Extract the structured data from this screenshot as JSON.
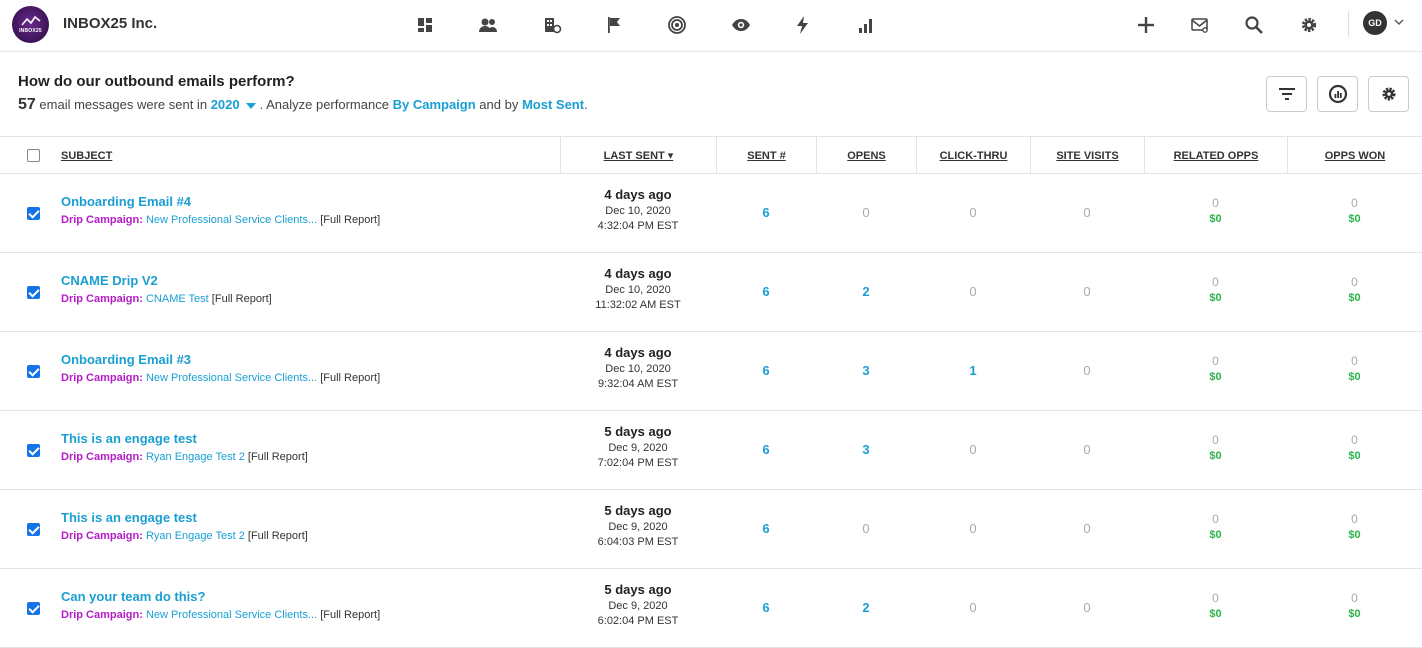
{
  "app": {
    "company": "INBOX25 Inc.",
    "logo_text": "INBOX25",
    "user_initials": "GD"
  },
  "nav_icons": [
    "dashboard-icon",
    "contacts-icon",
    "accounts-icon",
    "flag-icon",
    "target-icon",
    "eye-icon",
    "bolt-icon",
    "bar-chart-icon"
  ],
  "utility_icons": [
    "plus-icon",
    "mail-search-icon",
    "search-icon",
    "gear-icon"
  ],
  "header": {
    "title": "How do our outbound emails perform?",
    "count": "57",
    "text1": "email messages were sent in",
    "year": "2020",
    "text2": ". Analyze performance",
    "by_campaign": "By Campaign",
    "text3": "and by",
    "most_sent": "Most Sent",
    "text4": "."
  },
  "columns": {
    "subject": "SUBJECT",
    "last_sent": "LAST SENT ▾",
    "sent": "SENT #",
    "opens": "OPENS",
    "clickthru": "CLICK-THRU",
    "site_visits": "SITE VISITS",
    "related_opps": "RELATED OPPS",
    "opps_won": "OPPS WON"
  },
  "rows": [
    {
      "title": "Onboarding Email #4",
      "drip_label": "Drip Campaign:",
      "campaign": "New Professional Service Clients...",
      "report": "[Full Report]",
      "ago": "4 days ago",
      "date": "Dec 10, 2020",
      "time": "4:32:04 PM EST",
      "sent": "6",
      "opens": "0",
      "clicks": "0",
      "visits": "0",
      "rel_count": "0",
      "rel_amount": "$0",
      "won_count": "0",
      "won_amount": "$0"
    },
    {
      "title": "CNAME Drip V2",
      "drip_label": "Drip Campaign:",
      "campaign": "CNAME Test",
      "report": "[Full Report]",
      "ago": "4 days ago",
      "date": "Dec 10, 2020",
      "time": "11:32:02 AM EST",
      "sent": "6",
      "opens": "2",
      "clicks": "0",
      "visits": "0",
      "rel_count": "0",
      "rel_amount": "$0",
      "won_count": "0",
      "won_amount": "$0"
    },
    {
      "title": "Onboarding Email #3",
      "drip_label": "Drip Campaign:",
      "campaign": "New Professional Service Clients...",
      "report": "[Full Report]",
      "ago": "4 days ago",
      "date": "Dec 10, 2020",
      "time": "9:32:04 AM EST",
      "sent": "6",
      "opens": "3",
      "clicks": "1",
      "visits": "0",
      "rel_count": "0",
      "rel_amount": "$0",
      "won_count": "0",
      "won_amount": "$0"
    },
    {
      "title": "This is an engage test",
      "drip_label": "Drip Campaign:",
      "campaign": "Ryan Engage Test 2",
      "report": "[Full Report]",
      "ago": "5 days ago",
      "date": "Dec 9, 2020",
      "time": "7:02:04 PM EST",
      "sent": "6",
      "opens": "3",
      "clicks": "0",
      "visits": "0",
      "rel_count": "0",
      "rel_amount": "$0",
      "won_count": "0",
      "won_amount": "$0"
    },
    {
      "title": "This is an engage test",
      "drip_label": "Drip Campaign:",
      "campaign": "Ryan Engage Test 2",
      "report": "[Full Report]",
      "ago": "5 days ago",
      "date": "Dec 9, 2020",
      "time": "6:04:03 PM EST",
      "sent": "6",
      "opens": "0",
      "clicks": "0",
      "visits": "0",
      "rel_count": "0",
      "rel_amount": "$0",
      "won_count": "0",
      "won_amount": "$0"
    },
    {
      "title": "Can your team do this?",
      "drip_label": "Drip Campaign:",
      "campaign": "New Professional Service Clients...",
      "report": "[Full Report]",
      "ago": "5 days ago",
      "date": "Dec 9, 2020",
      "time": "6:02:04 PM EST",
      "sent": "6",
      "opens": "2",
      "clicks": "0",
      "visits": "0",
      "rel_count": "0",
      "rel_amount": "$0",
      "won_count": "0",
      "won_amount": "$0"
    }
  ],
  "colors": {
    "link": "#1a9fd3",
    "drip": "#b51cc7",
    "money": "#2db34a",
    "checkbox": "#1473e6"
  }
}
